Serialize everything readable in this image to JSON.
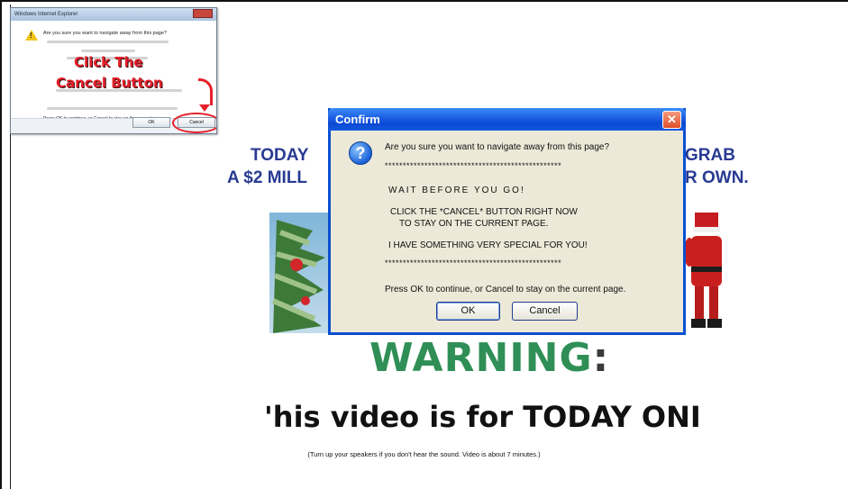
{
  "inset": {
    "window_title": "Windows Internet Explorer",
    "question": "Are you sure you want to navigate away from this page?",
    "callout_line1": "Click The",
    "callout_line2": "Cancel Button",
    "press_text": "Press OK to continue, or Cancel to stay on the current page.",
    "ok_label": "OK",
    "cancel_label": "Cancel"
  },
  "headline": {
    "left_line1": "TODAY",
    "left_line2": "A $2 MILL",
    "right_line1": "GRAB",
    "right_line2": "R OWN."
  },
  "warning": {
    "title": "WARNING",
    "colon": ":",
    "video_line": "'his video is for TODAY ONI",
    "note": "(Turn up your speakers if you don't hear the sound. Video is about 7 minutes.)"
  },
  "dialog": {
    "title": "Confirm",
    "close_glyph": "✕",
    "icon_glyph": "?",
    "question": "Are you sure you want to navigate away from this page?",
    "separator_top": "*************************************************",
    "wait_text": "WAIT BEFORE YOU GO!",
    "click_line1": "CLICK THE *CANCEL* BUTTON RIGHT NOW",
    "click_line2": "TO STAY ON THE CURRENT PAGE.",
    "special_text": "I HAVE SOMETHING VERY SPECIAL FOR YOU!",
    "separator_bottom": "*************************************************",
    "press_text": "Press OK to continue, or Cancel to stay on the current page.",
    "ok_label": "OK",
    "cancel_label": "Cancel"
  },
  "colors": {
    "headline": "#283a92",
    "warning": "#2f8f56",
    "dialog_title": "#0b4ad4",
    "callout": "#e4202b"
  }
}
